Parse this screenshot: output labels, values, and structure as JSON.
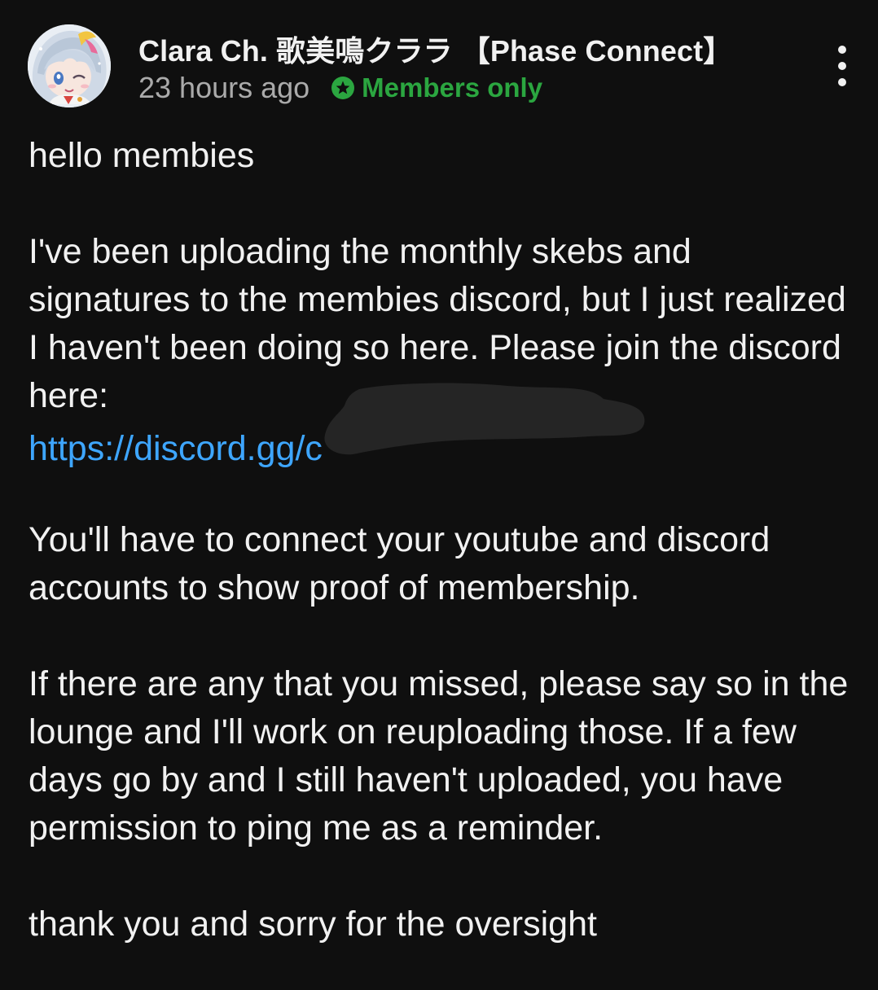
{
  "post": {
    "author": "Clara Ch. 歌美鳴クララ 【Phase Connect】",
    "timestamp": "23 hours ago",
    "members_badge": "Members only",
    "members_color": "#2ba640",
    "menu_icon": "more-vert-icon",
    "body": {
      "greeting": "hello membies",
      "paragraph1": "I've been uploading the monthly skebs and signatures to the membies discord, but I just realized I haven't been doing so here. Please join the discord here:",
      "link_text": "https://discord.gg/c",
      "link_color": "#3ea6ff",
      "paragraph2": "You'll have to connect your youtube and discord accounts to show proof of membership.",
      "paragraph3": "If there are any that you missed, please say so in the lounge and I'll work on reuploading those. If a few days go by and I still haven't uploaded, you have permission to ping me as a reminder.",
      "closing": "thank you and sorry for the oversight"
    }
  },
  "colors": {
    "background": "#0f0f0f",
    "text": "#f1f1f1",
    "secondary_text": "#aaaaaa"
  }
}
